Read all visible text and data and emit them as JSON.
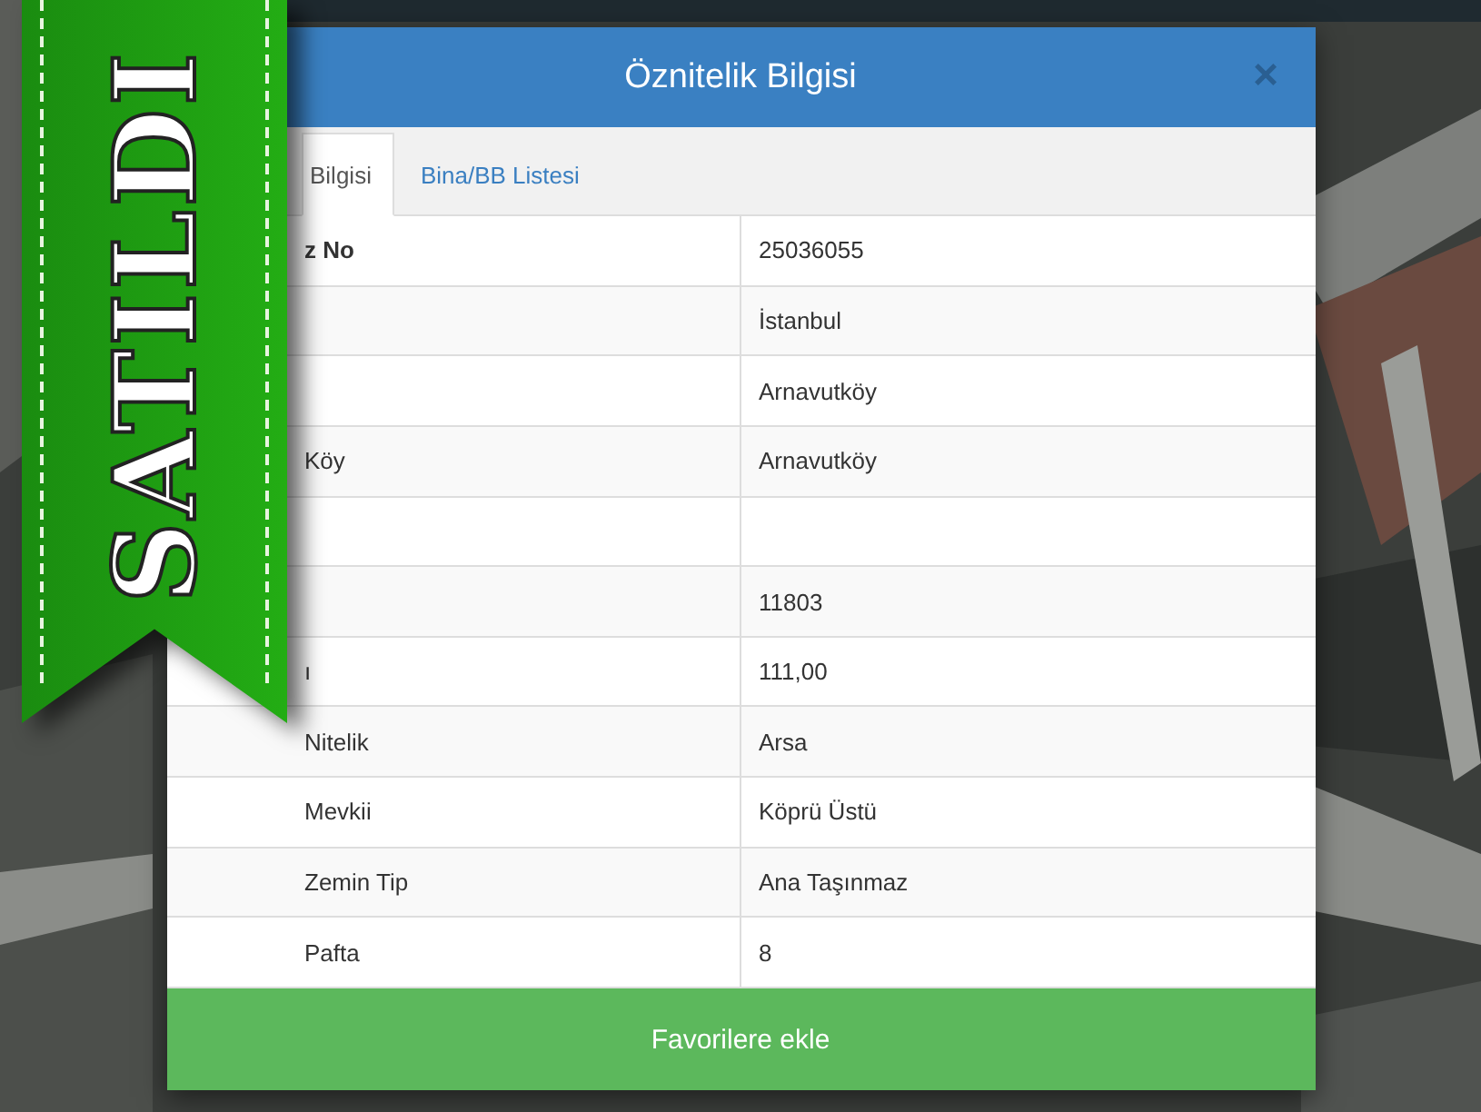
{
  "ribbon": {
    "text": "SATILDI"
  },
  "dialog": {
    "title": "Öznitelik Bilgisi",
    "close": "×"
  },
  "tabs": [
    {
      "label": "Bilgisi",
      "selected": true
    },
    {
      "label": "Bina/BB Listesi",
      "selected": false
    }
  ],
  "rows": [
    {
      "label": "z No",
      "value": "25036055"
    },
    {
      "label": "",
      "value": "İstanbul"
    },
    {
      "label": "",
      "value": "Arnavutköy"
    },
    {
      "label": "Köy",
      "value": "Arnavutköy"
    },
    {
      "label": "",
      "value": ""
    },
    {
      "label": "",
      "value": "11803"
    },
    {
      "label": "ı",
      "value": "111,00"
    },
    {
      "label": "Nitelik",
      "value": "Arsa"
    },
    {
      "label": "Mevkii",
      "value": "Köprü Üstü"
    },
    {
      "label": "Zemin Tip",
      "value": "Ana Taşınmaz"
    },
    {
      "label": "Pafta",
      "value": "8"
    }
  ],
  "button": {
    "label": "Favorilere ekle"
  }
}
